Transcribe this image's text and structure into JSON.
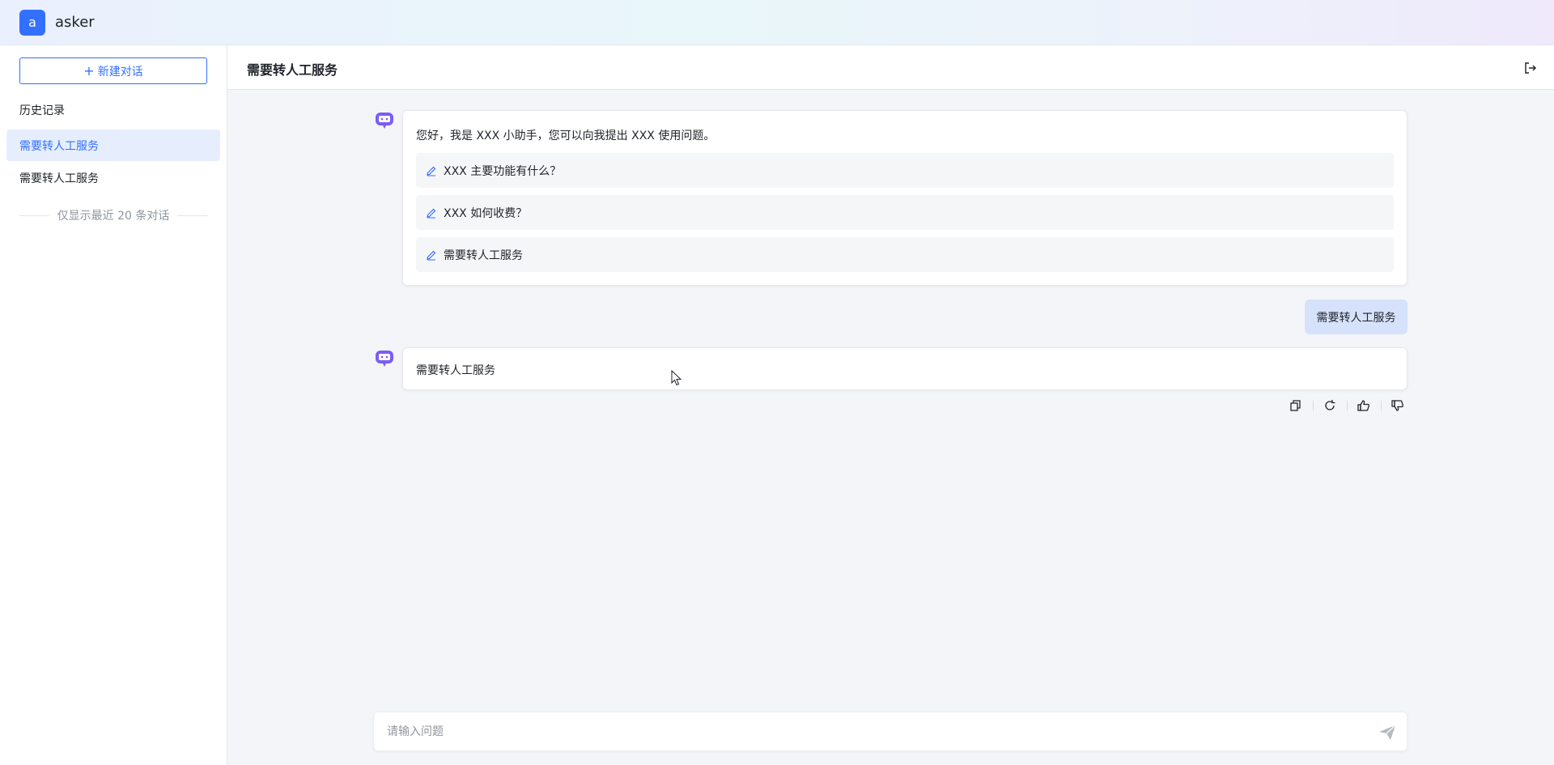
{
  "app": {
    "logo_letter": "a",
    "name": "asker"
  },
  "sidebar": {
    "new_chat_label": "新建对话",
    "history_title": "历史记录",
    "items": [
      {
        "label": "需要转人工服务",
        "active": true
      },
      {
        "label": "需要转人工服务",
        "active": false
      }
    ],
    "note": "仅显示最近 20 条对话"
  },
  "header": {
    "title": "需要转人工服务",
    "logout_icon": "logout-icon"
  },
  "chat": {
    "greeting": "您好，我是 XXX 小助手，您可以向我提出 XXX 使用问题。",
    "suggestions": [
      "XXX 主要功能有什么？",
      "XXX 如何收费？",
      "需要转人工服务"
    ],
    "user_message": "需要转人工服务",
    "bot_answer": "需要转人工服务",
    "actions": [
      "copy-icon",
      "refresh-icon",
      "thumbs-up-icon",
      "thumbs-down-icon"
    ]
  },
  "input": {
    "placeholder": "请输入问题"
  },
  "colors": {
    "accent": "#3370ff",
    "bot_avatar": "#7c5cf5",
    "user_bubble": "#d6e2fb"
  }
}
